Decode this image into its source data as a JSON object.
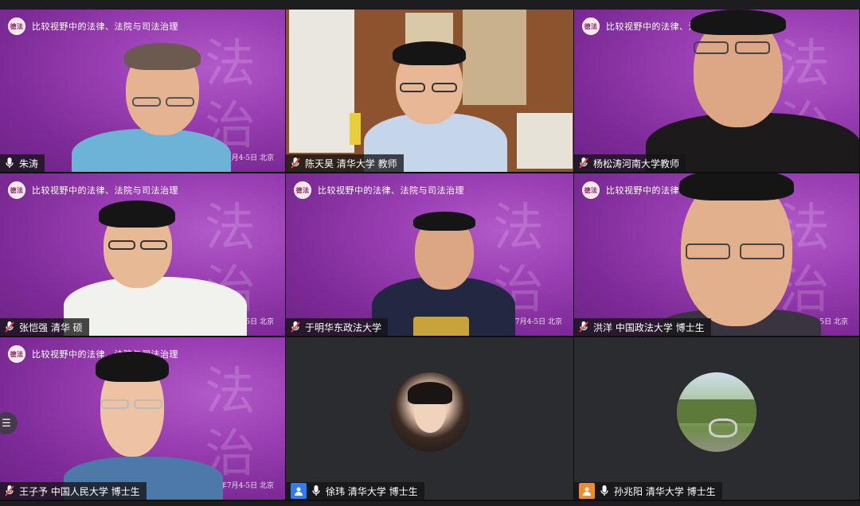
{
  "banner_title": "比较视野中的法律、法院与司法治理",
  "banner_logo_text": "德法",
  "background_calligraphy": [
    "法",
    "治"
  ],
  "date_caption": "2021年7月4-5日 北京",
  "tiles": [
    {
      "name": "朱涛",
      "mic_state": "on"
    },
    {
      "name": "陈天昊 清华大学 教师",
      "mic_state": "muted"
    },
    {
      "name": "杨松涛河南大学教师",
      "mic_state": "muted"
    },
    {
      "name": "张恺强 清华 硕",
      "mic_state": "muted"
    },
    {
      "name": "于明华东政法大学",
      "mic_state": "muted"
    },
    {
      "name": "洪洋 中国政法大学 博士生",
      "mic_state": "muted"
    },
    {
      "name": "王子予 中国人民大学 博士生",
      "mic_state": "muted"
    },
    {
      "name": "徐玮 清华大学 博士生",
      "mic_state": "on",
      "avatar_color": "#2f7cf6"
    },
    {
      "name": "孙兆阳 清华大学 博士生",
      "mic_state": "on",
      "avatar_color": "#f08c2b"
    }
  ],
  "side_button_icon": "list-icon",
  "colors": {
    "video_bg": "#8e35a8",
    "dark_tile": "#2b2c2f",
    "muted_red": "#e64545"
  }
}
